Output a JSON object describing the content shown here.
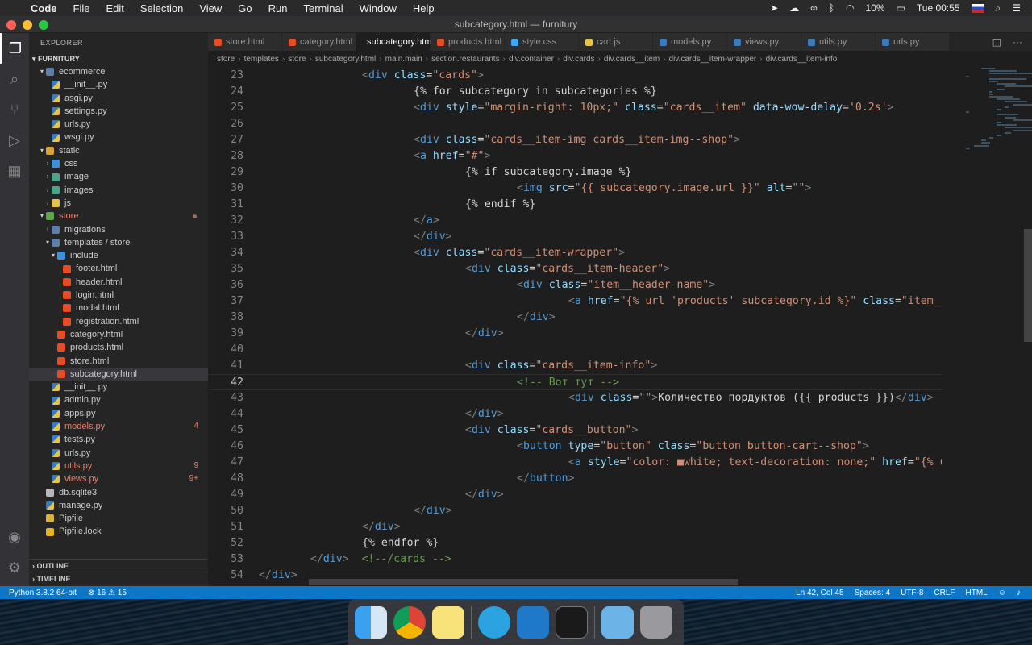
{
  "menubar": {
    "apple": "",
    "app": "Code",
    "items": [
      "File",
      "Edit",
      "Selection",
      "View",
      "Go",
      "Run",
      "Terminal",
      "Window",
      "Help"
    ],
    "battery": "10%",
    "clock": "Tue 00:55"
  },
  "window": {
    "title": "subcategory.html — furnitury"
  },
  "sidebar": {
    "title": "EXPLORER",
    "root": "FURNITURY",
    "rows": [
      {
        "label": "ecommerce",
        "depth": 1,
        "kind": "folder",
        "twisty": "▾"
      },
      {
        "label": "__init__.py",
        "depth": 2,
        "kind": "py"
      },
      {
        "label": "asgi.py",
        "depth": 2,
        "kind": "py"
      },
      {
        "label": "settings.py",
        "depth": 2,
        "kind": "py"
      },
      {
        "label": "urls.py",
        "depth": 2,
        "kind": "py"
      },
      {
        "label": "wsgi.py",
        "depth": 2,
        "kind": "py"
      },
      {
        "label": "static",
        "depth": 1,
        "kind": "folder st",
        "twisty": "▾"
      },
      {
        "label": "css",
        "depth": 2,
        "kind": "folder css",
        "twisty": "›"
      },
      {
        "label": "image",
        "depth": 2,
        "kind": "folder img",
        "twisty": "›"
      },
      {
        "label": "images",
        "depth": 2,
        "kind": "folder img",
        "twisty": "›"
      },
      {
        "label": "js",
        "depth": 2,
        "kind": "folder js",
        "twisty": "›"
      },
      {
        "label": "store",
        "depth": 1,
        "kind": "folder grn",
        "twisty": "▾",
        "err": true,
        "dot": true
      },
      {
        "label": "migrations",
        "depth": 2,
        "kind": "folder",
        "twisty": "›"
      },
      {
        "label": "templates / store",
        "depth": 2,
        "kind": "folder",
        "twisty": "▾"
      },
      {
        "label": "include",
        "depth": 3,
        "kind": "folder css",
        "twisty": "▾"
      },
      {
        "label": "footer.html",
        "depth": 4,
        "kind": "html"
      },
      {
        "label": "header.html",
        "depth": 4,
        "kind": "html"
      },
      {
        "label": "login.html",
        "depth": 4,
        "kind": "html"
      },
      {
        "label": "modal.html",
        "depth": 4,
        "kind": "html"
      },
      {
        "label": "registration.html",
        "depth": 4,
        "kind": "html"
      },
      {
        "label": "category.html",
        "depth": 3,
        "kind": "html"
      },
      {
        "label": "products.html",
        "depth": 3,
        "kind": "html"
      },
      {
        "label": "store.html",
        "depth": 3,
        "kind": "html"
      },
      {
        "label": "subcategory.html",
        "depth": 3,
        "kind": "html",
        "sel": true
      },
      {
        "label": "__init__.py",
        "depth": 2,
        "kind": "py"
      },
      {
        "label": "admin.py",
        "depth": 2,
        "kind": "py"
      },
      {
        "label": "apps.py",
        "depth": 2,
        "kind": "py"
      },
      {
        "label": "models.py",
        "depth": 2,
        "kind": "py",
        "err": true,
        "badge": "4"
      },
      {
        "label": "tests.py",
        "depth": 2,
        "kind": "py"
      },
      {
        "label": "urls.py",
        "depth": 2,
        "kind": "py"
      },
      {
        "label": "utils.py",
        "depth": 2,
        "kind": "py",
        "err": true,
        "badge": "9"
      },
      {
        "label": "views.py",
        "depth": 2,
        "kind": "py",
        "err": true,
        "badge": "9+"
      },
      {
        "label": "db.sqlite3",
        "depth": 1,
        "kind": "db"
      },
      {
        "label": "manage.py",
        "depth": 1,
        "kind": "py"
      },
      {
        "label": "Pipfile",
        "depth": 1,
        "kind": "pipf"
      },
      {
        "label": "Pipfile.lock",
        "depth": 1,
        "kind": "lock"
      }
    ],
    "outline": "OUTLINE",
    "timeline": "TIMELINE"
  },
  "tabs": [
    {
      "label": "store.html",
      "kind": "html"
    },
    {
      "label": "category.html",
      "kind": "html"
    },
    {
      "label": "subcategory.html",
      "kind": "html",
      "active": true
    },
    {
      "label": "products.html",
      "kind": "html"
    },
    {
      "label": "style.css",
      "kind": "css"
    },
    {
      "label": "cart.js",
      "kind": "js"
    },
    {
      "label": "models.py",
      "kind": "py"
    },
    {
      "label": "views.py",
      "kind": "py"
    },
    {
      "label": "utils.py",
      "kind": "py"
    },
    {
      "label": "urls.py",
      "kind": "py"
    }
  ],
  "breadcrumbs": [
    "store",
    "templates",
    "store",
    "subcategory.html",
    "main.main",
    "section.restaurants",
    "div.container",
    "div.cards",
    "div.cards__item",
    "div.cards__item-wrapper",
    "div.cards__item-info"
  ],
  "code": [
    {
      "n": "23",
      "i": 16,
      "t": [
        [
          "<",
          "pu"
        ],
        [
          "div",
          "tg"
        ],
        [
          " class",
          "at"
        ],
        [
          "=",
          ""
        ],
        [
          "\"cards\"",
          "st"
        ],
        [
          ">",
          "pu"
        ]
      ]
    },
    {
      "n": "24",
      "i": 24,
      "t": [
        [
          "{% for subcategory in subcategories %}",
          ""
        ]
      ]
    },
    {
      "n": "25",
      "i": 24,
      "t": [
        [
          "<",
          "pu"
        ],
        [
          "div",
          "tg"
        ],
        [
          " style",
          "at"
        ],
        [
          "=",
          ""
        ],
        [
          "\"margin-right: 10px;\"",
          "st"
        ],
        [
          " class",
          "at"
        ],
        [
          "=",
          ""
        ],
        [
          "\"cards__item\"",
          "st"
        ],
        [
          " data-wow-delay",
          "at"
        ],
        [
          "=",
          ""
        ],
        [
          "'0.2s'",
          "st"
        ],
        [
          ">",
          "pu"
        ]
      ]
    },
    {
      "n": "26",
      "i": 0,
      "t": []
    },
    {
      "n": "27",
      "i": 24,
      "t": [
        [
          "<",
          "pu"
        ],
        [
          "div",
          "tg"
        ],
        [
          " class",
          "at"
        ],
        [
          "=",
          ""
        ],
        [
          "\"cards__item-img cards__item-img--shop\"",
          "st"
        ],
        [
          ">",
          "pu"
        ]
      ]
    },
    {
      "n": "28",
      "i": 24,
      "t": [
        [
          "<",
          "pu"
        ],
        [
          "a",
          "tg"
        ],
        [
          " href",
          "at"
        ],
        [
          "=",
          ""
        ],
        [
          "\"#\"",
          "st"
        ],
        [
          ">",
          "pu"
        ]
      ]
    },
    {
      "n": "29",
      "i": 32,
      "t": [
        [
          "{% if subcategory.image %}",
          ""
        ]
      ]
    },
    {
      "n": "30",
      "i": 40,
      "t": [
        [
          "<",
          "pu"
        ],
        [
          "img",
          "tg"
        ],
        [
          " src",
          "at"
        ],
        [
          "=",
          ""
        ],
        [
          "\"{{ subcategory.image.url }}\"",
          "st"
        ],
        [
          " alt",
          "at"
        ],
        [
          "=",
          ""
        ],
        [
          "\"\"",
          "st"
        ],
        [
          ">",
          "pu"
        ]
      ]
    },
    {
      "n": "31",
      "i": 32,
      "t": [
        [
          "{% endif %}",
          ""
        ]
      ]
    },
    {
      "n": "32",
      "i": 24,
      "t": [
        [
          "</",
          "pu"
        ],
        [
          "a",
          "tg"
        ],
        [
          ">",
          "pu"
        ]
      ]
    },
    {
      "n": "33",
      "i": 24,
      "t": [
        [
          "</",
          "pu"
        ],
        [
          "div",
          "tg"
        ],
        [
          ">",
          "pu"
        ]
      ]
    },
    {
      "n": "34",
      "i": 24,
      "t": [
        [
          "<",
          "pu"
        ],
        [
          "div",
          "tg"
        ],
        [
          " class",
          "at"
        ],
        [
          "=",
          ""
        ],
        [
          "\"cards__item-wrapper\"",
          "st"
        ],
        [
          ">",
          "pu"
        ]
      ]
    },
    {
      "n": "35",
      "i": 32,
      "t": [
        [
          "<",
          "pu"
        ],
        [
          "div",
          "tg"
        ],
        [
          " class",
          "at"
        ],
        [
          "=",
          ""
        ],
        [
          "\"cards__item-header\"",
          "st"
        ],
        [
          ">",
          "pu"
        ]
      ]
    },
    {
      "n": "36",
      "i": 40,
      "t": [
        [
          "<",
          "pu"
        ],
        [
          "div",
          "tg"
        ],
        [
          " class",
          "at"
        ],
        [
          "=",
          ""
        ],
        [
          "\"item__header-name\"",
          "st"
        ],
        [
          ">",
          "pu"
        ]
      ]
    },
    {
      "n": "37",
      "i": 48,
      "t": [
        [
          "<",
          "pu"
        ],
        [
          "a",
          "tg"
        ],
        [
          " href",
          "at"
        ],
        [
          "=",
          ""
        ],
        [
          "\"{% url 'products' subcategory.id %}\"",
          "st"
        ],
        [
          " class",
          "at"
        ],
        [
          "=",
          ""
        ],
        [
          "\"item__header-link item__heade",
          "st"
        ]
      ]
    },
    {
      "n": "38",
      "i": 40,
      "t": [
        [
          "</",
          "pu"
        ],
        [
          "div",
          "tg"
        ],
        [
          ">",
          "pu"
        ]
      ]
    },
    {
      "n": "39",
      "i": 32,
      "t": [
        [
          "</",
          "pu"
        ],
        [
          "div",
          "tg"
        ],
        [
          ">",
          "pu"
        ]
      ]
    },
    {
      "n": "40",
      "i": 0,
      "t": []
    },
    {
      "n": "41",
      "i": 32,
      "t": [
        [
          "<",
          "pu"
        ],
        [
          "div",
          "tg"
        ],
        [
          " class",
          "at"
        ],
        [
          "=",
          ""
        ],
        [
          "\"cards__item-info\"",
          "st"
        ],
        [
          ">",
          "pu"
        ]
      ]
    },
    {
      "n": "42",
      "i": 40,
      "t": [
        [
          "<!-- Вот тут -->",
          "cm"
        ]
      ],
      "cur": true
    },
    {
      "n": "43",
      "i": 48,
      "t": [
        [
          "<",
          "pu"
        ],
        [
          "div",
          "tg"
        ],
        [
          " class",
          "at"
        ],
        [
          "=",
          ""
        ],
        [
          "\"\"",
          "st"
        ],
        [
          ">",
          "pu"
        ],
        [
          "Количество пордуктов ({{ products }})",
          ""
        ],
        [
          "</",
          "pu"
        ],
        [
          "div",
          "tg"
        ],
        [
          ">",
          "pu"
        ]
      ]
    },
    {
      "n": "44",
      "i": 32,
      "t": [
        [
          "</",
          "pu"
        ],
        [
          "div",
          "tg"
        ],
        [
          ">",
          "pu"
        ]
      ]
    },
    {
      "n": "45",
      "i": 32,
      "t": [
        [
          "<",
          "pu"
        ],
        [
          "div",
          "tg"
        ],
        [
          " class",
          "at"
        ],
        [
          "=",
          ""
        ],
        [
          "\"cards__button\"",
          "st"
        ],
        [
          ">",
          "pu"
        ]
      ]
    },
    {
      "n": "46",
      "i": 40,
      "t": [
        [
          "<",
          "pu"
        ],
        [
          "button",
          "tg"
        ],
        [
          " type",
          "at"
        ],
        [
          "=",
          ""
        ],
        [
          "\"button\"",
          "st"
        ],
        [
          " class",
          "at"
        ],
        [
          "=",
          ""
        ],
        [
          "\"button button-cart--shop\"",
          "st"
        ],
        [
          ">",
          "pu"
        ]
      ]
    },
    {
      "n": "47",
      "i": 48,
      "t": [
        [
          "<",
          "pu"
        ],
        [
          "a",
          "tg"
        ],
        [
          " style",
          "at"
        ],
        [
          "=",
          ""
        ],
        [
          "\"color: ■white; text-decoration: none;\"",
          "st"
        ],
        [
          " href",
          "at"
        ],
        [
          "=",
          ""
        ],
        [
          "\"{% url 'products' subcateg",
          "st"
        ]
      ]
    },
    {
      "n": "48",
      "i": 40,
      "t": [
        [
          "</",
          "pu"
        ],
        [
          "button",
          "tg"
        ],
        [
          ">",
          "pu"
        ]
      ]
    },
    {
      "n": "49",
      "i": 32,
      "t": [
        [
          "</",
          "pu"
        ],
        [
          "div",
          "tg"
        ],
        [
          ">",
          "pu"
        ]
      ]
    },
    {
      "n": "50",
      "i": 24,
      "t": [
        [
          "</",
          "pu"
        ],
        [
          "div",
          "tg"
        ],
        [
          ">",
          "pu"
        ]
      ]
    },
    {
      "n": "51",
      "i": 16,
      "t": [
        [
          "</",
          "pu"
        ],
        [
          "div",
          "tg"
        ],
        [
          ">",
          "pu"
        ]
      ]
    },
    {
      "n": "52",
      "i": 16,
      "t": [
        [
          "{% endfor %}",
          ""
        ]
      ]
    },
    {
      "n": "53",
      "i": 8,
      "t": [
        [
          "</",
          "pu"
        ],
        [
          "div",
          "tg"
        ],
        [
          ">",
          "pu"
        ],
        [
          "  ",
          ""
        ],
        [
          "<!--/cards -->",
          "cm"
        ]
      ]
    },
    {
      "n": "54",
      "i": 0,
      "t": [
        [
          "</",
          "pu"
        ],
        [
          "div",
          "tg"
        ],
        [
          ">",
          "pu"
        ]
      ]
    }
  ],
  "status": {
    "python": "Python 3.8.2 64-bit",
    "problems": "⊗ 16 ⚠ 15",
    "position": "Ln 42, Col 45",
    "spaces": "Spaces: 4",
    "encoding": "UTF-8",
    "eol": "CRLF",
    "lang": "HTML"
  },
  "colors": {
    "statusbar": "#0e76c7",
    "editor_bg": "#1e1e1e",
    "sidebar_bg": "#252526"
  }
}
